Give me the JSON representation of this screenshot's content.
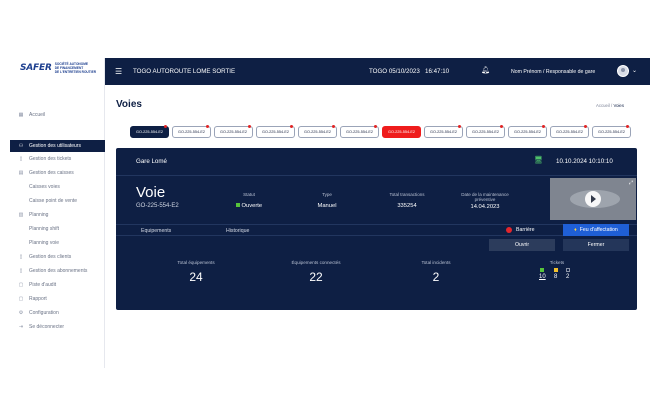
{
  "logo": {
    "mark": "SAFER",
    "line1": "SOCIÉTÉ AUTONOME",
    "line2": "DE FINANCEMENT",
    "line3": "DE L'ENTRETIEN ROUTIER"
  },
  "sidebar": {
    "items": [
      {
        "label": "Accueil",
        "icon": "grid-icon"
      },
      {
        "label": "Gestion des utilisateurs",
        "icon": "users-icon",
        "active": true
      },
      {
        "label": "Gestion des tickets",
        "icon": "ticket-icon"
      },
      {
        "label": "Gestion des caisses",
        "icon": "cash-icon"
      },
      {
        "label": "Caisses voies",
        "sub": true
      },
      {
        "label": "Caisse point de vente",
        "sub": true
      },
      {
        "label": "Planning",
        "icon": "calendar-icon"
      },
      {
        "label": "Planning shift",
        "sub": true
      },
      {
        "label": "Planning voie",
        "sub": true
      },
      {
        "label": "Gestion des clients",
        "icon": "client-icon"
      },
      {
        "label": "Gestion des abonnements",
        "icon": "subscription-icon"
      },
      {
        "label": "Piste d'audit",
        "icon": "audit-icon"
      },
      {
        "label": "Rapport",
        "icon": "report-icon"
      },
      {
        "label": "Configuration",
        "icon": "gear-icon"
      },
      {
        "label": "Se déconnecter",
        "icon": "logout-icon"
      }
    ]
  },
  "topbar": {
    "title": "TOGO AUTOROUTE LOME SORTIE",
    "date": "TOGO 05/10/2023",
    "time": "16:47:10",
    "user_name": "Nom Prénom",
    "user_role": "/ Responsable de gare"
  },
  "page": {
    "title": "Voies",
    "breadcrumb_home": "Accueil",
    "breadcrumb_sep": " / ",
    "breadcrumb_current": "Voies"
  },
  "lanes": [
    {
      "label": "GO-225-554-E2",
      "state": "selected"
    },
    {
      "label": "GO-225-554-E2",
      "state": "normal"
    },
    {
      "label": "GO-225-554-E2",
      "state": "normal"
    },
    {
      "label": "GO-225-554-E2",
      "state": "normal"
    },
    {
      "label": "GO-225-554-E2",
      "state": "normal"
    },
    {
      "label": "GO-225-554-E2",
      "state": "normal"
    },
    {
      "label": "GO-225-554-E2",
      "state": "alert"
    },
    {
      "label": "GO-225-554-E2",
      "state": "normal"
    },
    {
      "label": "GO-225-554-E2",
      "state": "normal"
    },
    {
      "label": "GO-225-554-E2",
      "state": "normal"
    },
    {
      "label": "GO-225-554-E2",
      "state": "normal"
    },
    {
      "label": "GO-225-554-E2",
      "state": "normal"
    }
  ],
  "card": {
    "station": "Gare Lomé",
    "datetime": "10.10.2024 10:10:10",
    "lane_name": "Voie",
    "lane_code": "GO-225-554-E2",
    "status_label": "Statut",
    "status_value": "Ouverte",
    "type_label": "Type",
    "type_value": "Manuel",
    "transactions_label": "Total transactions",
    "transactions_value": "335254",
    "maintenance_label_1": "Date de la maintenance",
    "maintenance_label_2": "préventive",
    "maintenance_value": "14.04.2023",
    "tab_equipments": "Equipements",
    "tab_history": "Historique",
    "barrier_label": "Barrière",
    "light_label": "Feu d'affectation",
    "open_button": "Ouvrir",
    "close_button": "Fermer",
    "metrics": [
      {
        "label": "Total équipements",
        "value": "24"
      },
      {
        "label": "Équipements connectés",
        "value": "22"
      },
      {
        "label": "Total incidents",
        "value": "2"
      }
    ],
    "tickets_label": "Tickets",
    "tickets": [
      {
        "value": "10",
        "color": "#57c43b",
        "underline": true
      },
      {
        "value": "8",
        "color": "#f2c12e",
        "underline": false
      },
      {
        "value": "2",
        "color": "#0e1f44",
        "underline": false
      }
    ]
  },
  "colors": {
    "navy": "#0e1f44",
    "accent_blue": "#1f5fd6",
    "alert_red": "#ef1c1c",
    "status_green": "#57c43b"
  }
}
